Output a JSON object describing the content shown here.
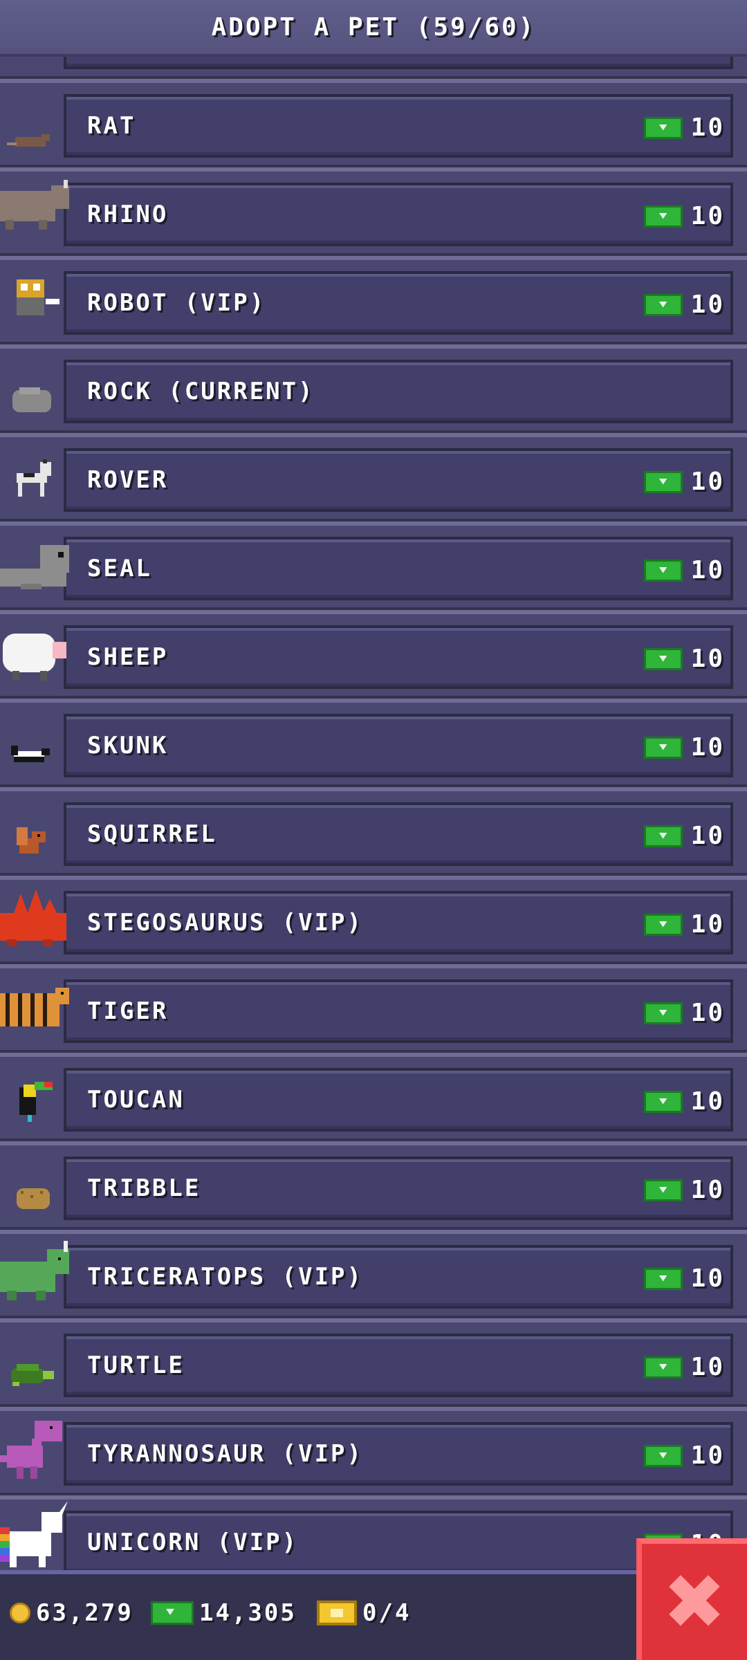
{
  "header": {
    "title": "ADOPT A PET (59/60)"
  },
  "pets": [
    {
      "name": "RAT",
      "price": "10",
      "icon": "rat-icon"
    },
    {
      "name": "RHINO",
      "price": "10",
      "icon": "rhino-icon"
    },
    {
      "name": "ROBOT (VIP)",
      "price": "10",
      "icon": "robot-icon"
    },
    {
      "name": "ROCK (CURRENT)",
      "price": "",
      "icon": "rock-icon"
    },
    {
      "name": "ROVER",
      "price": "10",
      "icon": "rover-icon"
    },
    {
      "name": "SEAL",
      "price": "10",
      "icon": "seal-icon"
    },
    {
      "name": "SHEEP",
      "price": "10",
      "icon": "sheep-icon"
    },
    {
      "name": "SKUNK",
      "price": "10",
      "icon": "skunk-icon"
    },
    {
      "name": "SQUIRREL",
      "price": "10",
      "icon": "squirrel-icon"
    },
    {
      "name": "STEGOSAURUS (VIP)",
      "price": "10",
      "icon": "stegosaurus-icon"
    },
    {
      "name": "TIGER",
      "price": "10",
      "icon": "tiger-icon"
    },
    {
      "name": "TOUCAN",
      "price": "10",
      "icon": "toucan-icon"
    },
    {
      "name": "TRIBBLE",
      "price": "10",
      "icon": "tribble-icon"
    },
    {
      "name": "TRICERATOPS (VIP)",
      "price": "10",
      "icon": "triceratops-icon"
    },
    {
      "name": "TURTLE",
      "price": "10",
      "icon": "turtle-icon"
    },
    {
      "name": "TYRANNOSAUR (VIP)",
      "price": "10",
      "icon": "tyrannosaur-icon"
    },
    {
      "name": "UNICORN (VIP)",
      "price": "10",
      "icon": "unicorn-icon"
    }
  ],
  "footer": {
    "coins": "63,279",
    "bux": "14,305",
    "tickets": "0/4"
  },
  "colors": {
    "cash_green": "#2fb53a",
    "close_red": "#e0323a",
    "coin_gold": "#f2c13a"
  }
}
